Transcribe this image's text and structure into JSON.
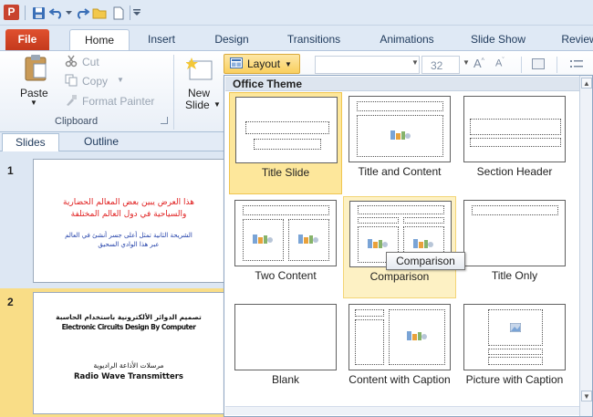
{
  "app_logo": "P",
  "tabs": [
    "File",
    "Home",
    "Insert",
    "Design",
    "Transitions",
    "Animations",
    "Slide Show",
    "Review"
  ],
  "clipboard": {
    "paste_label": "Paste",
    "cut_label": "Cut",
    "copy_label": "Copy",
    "format_painter_label": "Format Painter",
    "group_label": "Clipboard"
  },
  "slides_group": {
    "new_slide_line1": "New",
    "new_slide_line2": "Slide"
  },
  "layout_button_label": "Layout",
  "font_size_value": "32",
  "panes": {
    "slides_tab": "Slides",
    "outline_tab": "Outline"
  },
  "slides": [
    {
      "number": "1",
      "line1": "هذا العرض يبين بعض المعالم الحضارية",
      "line2": "والسياحية في دول العالم المختلفة",
      "line3": "الشريحة الثانية تمثل أعلى جسر أنشئ في العالم",
      "line4": "عبر هذا الوادي السحيق"
    },
    {
      "number": "2",
      "line1": "تصميم الدوائر الألكترونية باستخدام الحاسبة",
      "line2": "Electronic Circuits Design By Computer",
      "line3": "مرسلات الأذاعة الراديوية",
      "line4": "Radio Wave Transmitters"
    }
  ],
  "dropdown": {
    "header": "Office Theme",
    "layouts": [
      {
        "name": "Title Slide"
      },
      {
        "name": "Title and Content"
      },
      {
        "name": "Section Header"
      },
      {
        "name": "Two Content"
      },
      {
        "name": "Comparison"
      },
      {
        "name": "Title Only"
      },
      {
        "name": "Blank"
      },
      {
        "name": "Content with Caption"
      },
      {
        "name": "Picture with Caption"
      }
    ],
    "tooltip": "Comparison"
  },
  "colors": {
    "accent": "#c43a1d",
    "selected": "#fde79b",
    "slide1_red_text": "#e02020",
    "slide1_blue_text": "#1f3ea8"
  }
}
